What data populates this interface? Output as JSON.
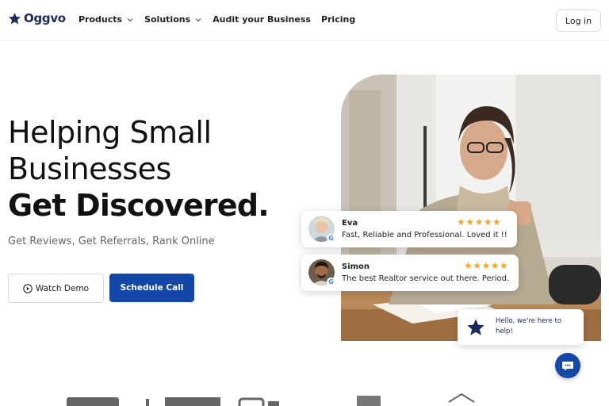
{
  "nav": {
    "logo_text": "Oggvo",
    "links": [
      {
        "label": "Products",
        "has_dropdown": true
      },
      {
        "label": "Solutions",
        "has_dropdown": true
      },
      {
        "label": "Audit your Business",
        "has_dropdown": false
      },
      {
        "label": "Pricing",
        "has_dropdown": false
      }
    ],
    "login_label": "Log in"
  },
  "hero": {
    "title_line1": "Helping Small",
    "title_line2": "Businesses",
    "title_line3": "Get Discovered.",
    "subtitle": "Get Reviews, Get Referrals, Rank Online",
    "watch_demo_label": "Watch Demo",
    "schedule_call_label": "Schedule Call"
  },
  "reviews": [
    {
      "name": "Eva",
      "text": "Fast, Reliable and Professional. Loved it !!",
      "rating": 5,
      "stars": "★★★★★"
    },
    {
      "name": "Simon",
      "text": "The best Realtor service out there. Period.",
      "rating": 5,
      "stars": "★★★★★"
    }
  ],
  "chat": {
    "message": "Hello, we're here to help!"
  },
  "colors": {
    "brand_navy": "#1b2a5a",
    "primary_blue": "#1447a8",
    "star_gold": "#f5a623"
  },
  "icons": [
    "star-logo-icon",
    "chevron-down-icon",
    "play-circle-icon",
    "google-icon",
    "chat-bubble-icon"
  ]
}
